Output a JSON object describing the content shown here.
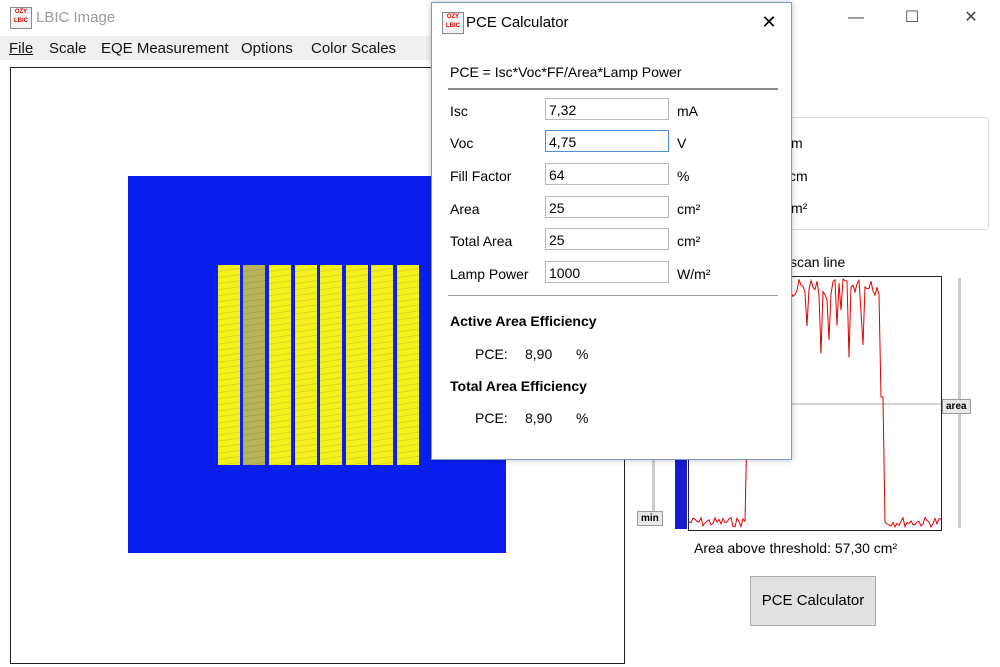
{
  "window": {
    "app_icon_text": "OZY LBIC",
    "title": "LBIC Image",
    "minimize_glyph": "—",
    "maximize_glyph": "☐",
    "close_glyph": "✕"
  },
  "menu": [
    "File",
    "Scale",
    "EQE Measurement",
    "Options",
    "Color Scales"
  ],
  "sample_image": {
    "background_color": "#0a1ef0",
    "cell_color": "#f4f01c",
    "strip_count": 8
  },
  "right_panel": {
    "info_fragments": [
      "m",
      "cm",
      "m²"
    ],
    "scan_line_label": "scan line",
    "slider_min_label": "min",
    "slider_area_label": "area",
    "threshold_text": "Area above threshold: 57,30 cm²",
    "pce_button_label": "PCE Calculator",
    "profile_color": "#e00000"
  },
  "dialog": {
    "icon_text": "OZY LBIC",
    "title": "PCE Calculator",
    "close_glyph": "✕",
    "formula": "PCE = Isc*Voc*FF/Area*Lamp Power",
    "fields": [
      {
        "label": "Isc",
        "value": "7,32",
        "unit": "mA"
      },
      {
        "label": "Voc",
        "value": "4,75",
        "unit": "V"
      },
      {
        "label": "Fill Factor",
        "value": "64",
        "unit": "%"
      },
      {
        "label": "Area",
        "value": "25",
        "unit": "cm²"
      },
      {
        "label": "Total Area",
        "value": "25",
        "unit": "cm²"
      },
      {
        "label": "Lamp Power",
        "value": "1000",
        "unit": "W/m²"
      }
    ],
    "active": {
      "heading": "Active Area Efficiency",
      "pce_label": "PCE:",
      "pce_value": "8,90",
      "unit": "%"
    },
    "total": {
      "heading": "Total Area Efficiency",
      "pce_label": "PCE:",
      "pce_value": "8,90",
      "unit": "%"
    }
  }
}
